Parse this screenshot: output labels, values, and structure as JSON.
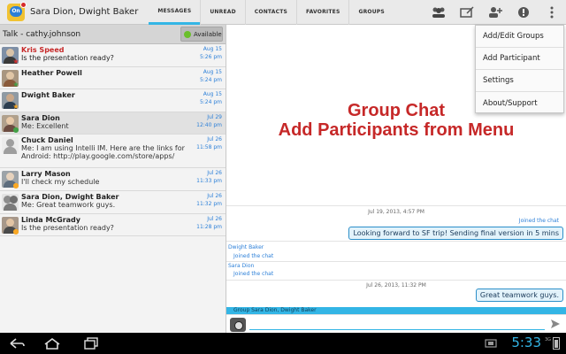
{
  "app": {
    "title": "Sara Dion, Dwight Baker",
    "icon_text": "On"
  },
  "tabs": [
    {
      "label": "MESSAGES",
      "active": true
    },
    {
      "label": "UNREAD",
      "active": false
    },
    {
      "label": "CONTACTS",
      "active": false
    },
    {
      "label": "FAVORITES",
      "active": false
    },
    {
      "label": "GROUPS",
      "active": false
    }
  ],
  "action_icons": [
    "group-icon",
    "compose-icon",
    "add-person-icon",
    "info-icon",
    "overflow-icon"
  ],
  "left_panel": {
    "talk_label": "Talk - cathy.johnson",
    "availability": "Available",
    "conversations": [
      {
        "name": "Kris Speed",
        "msg": "Is the presentation ready?",
        "date": "Aug 15",
        "time": "5:26 pm",
        "highlight": true,
        "badge": "star-red"
      },
      {
        "name": "Heather Powell",
        "msg": "",
        "date": "Aug 15",
        "time": "5:24 pm",
        "highlight": false,
        "badge": "star-green"
      },
      {
        "name": "Dwight Baker",
        "msg": "",
        "date": "Aug 15",
        "time": "5:24 pm",
        "highlight": false,
        "badge": "star-yellow"
      },
      {
        "name": "Sara Dion",
        "msg": "Me: Excellent",
        "date": "Jul 29",
        "time": "12:40 pm",
        "highlight": false,
        "badge": "dot-green"
      },
      {
        "name": "Chuck Daniel",
        "msg": "Me: I am using Intelli IM. Here are the links for Android: http://play.google.com/store/apps/",
        "msg_line1": "Me: I am using Intelli IM. Here are the links for",
        "msg_line2": "Android: http://play.google.com/store/apps/",
        "date": "Jul 26",
        "time": "11:58 pm",
        "highlight": false,
        "badge": ""
      },
      {
        "name": "Larry Mason",
        "msg": "I'll check my schedule",
        "date": "Jul 26",
        "time": "11:33 pm",
        "highlight": false,
        "badge": "dot-yellow"
      },
      {
        "name": "Sara Dion, Dwight Baker",
        "msg": "Me: Great teamwork guys.",
        "date": "Jul 26",
        "time": "11:32 pm",
        "highlight": false,
        "badge": ""
      },
      {
        "name": "Linda McGrady",
        "msg": "Is the presentation ready?",
        "date": "Jul 26",
        "time": "11:28 pm",
        "highlight": false,
        "badge": "dot-yellow"
      }
    ]
  },
  "overlay": {
    "line1": "Group Chat",
    "line2": "Add Participants from Menu",
    "color": "#c62828"
  },
  "chat": {
    "ts1": "Jul 19, 2013, 4:57 PM",
    "joined_right": "Joined the chat",
    "bubble1": "Looking forward to SF trip! Sending final version in 5 mins",
    "sender1": "Dwight Baker",
    "joined1": "Joined the chat",
    "sender2": "Sara Dion",
    "joined2": "Joined the chat",
    "ts2": "Jul 26, 2013, 11:32 PM",
    "bubble2": "Great teamwork guys.",
    "group_bar": "Group  Sara Dion, Dwight Baker"
  },
  "menu": {
    "items": [
      "Add/Edit Groups",
      "Add Participant",
      "Settings",
      "About/Support"
    ]
  },
  "system": {
    "clock": "5:33",
    "signal_label": "3G"
  },
  "colors": {
    "accent": "#33b5e5",
    "link": "#2b7fd8",
    "highlight": "#c62828"
  }
}
